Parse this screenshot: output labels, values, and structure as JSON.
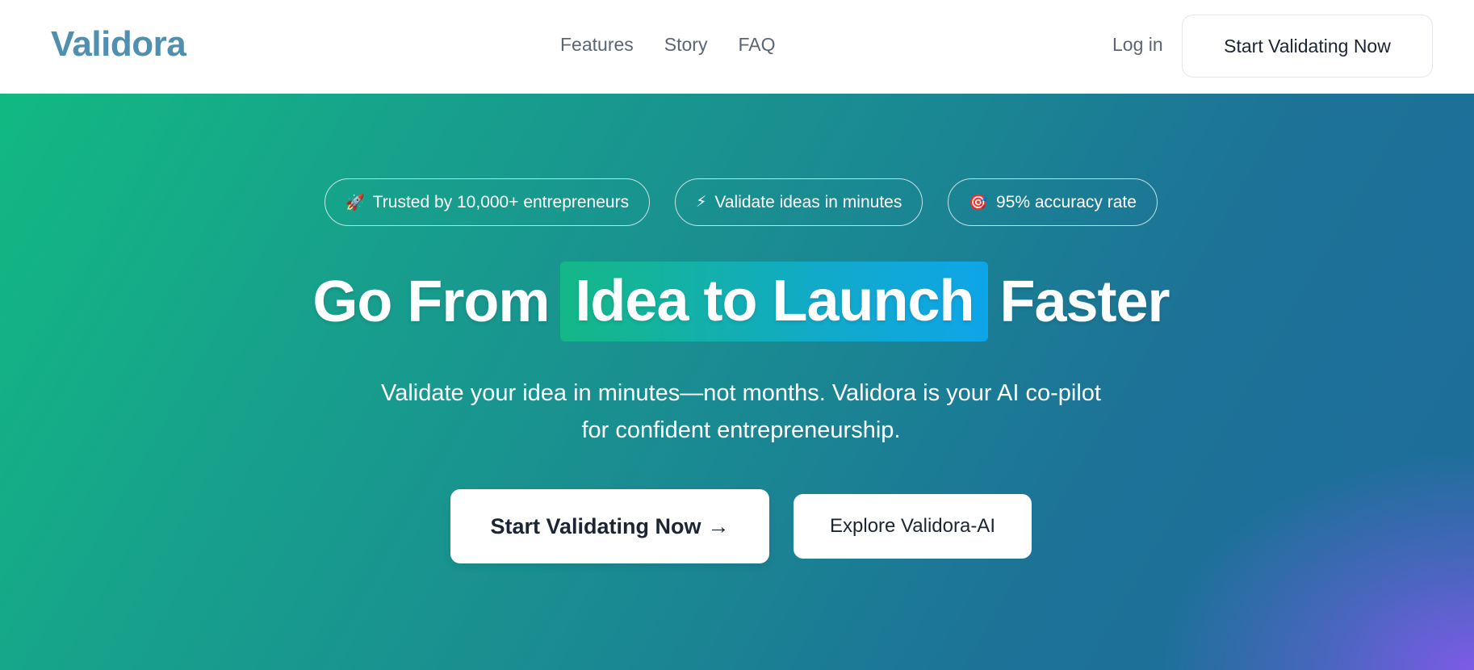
{
  "header": {
    "logo": "Validora",
    "nav": [
      {
        "label": "Features"
      },
      {
        "label": "Story"
      },
      {
        "label": "FAQ"
      }
    ],
    "login_label": "Log in",
    "cta_label": "Start Validating Now"
  },
  "hero": {
    "badges": [
      {
        "icon": "🚀",
        "icon_name": "rocket-icon",
        "label": "Trusted by 10,000+ entrepreneurs"
      },
      {
        "icon": "⚡",
        "icon_name": "lightning-icon",
        "label": "Validate ideas in minutes"
      },
      {
        "icon": "🎯",
        "icon_name": "target-icon",
        "label": "95% accuracy rate"
      }
    ],
    "headline_start": "Go From",
    "headline_highlight": "Idea to Launch",
    "headline_end": "Faster",
    "subtitle_line1": "Validate your idea in minutes—not months. Validora is your AI co-pilot",
    "subtitle_line2": "for confident entrepreneurship.",
    "primary_cta": "Start Validating Now",
    "primary_cta_arrow": "→",
    "secondary_cta": "Explore Validora-AI"
  },
  "colors": {
    "logo": "#4f8fb0",
    "gradient_start": "#12b982",
    "gradient_mid": "#1c7397",
    "gradient_corner": "#7a5ae8",
    "highlight_start": "#14b886",
    "highlight_end": "#0ea5e9"
  }
}
